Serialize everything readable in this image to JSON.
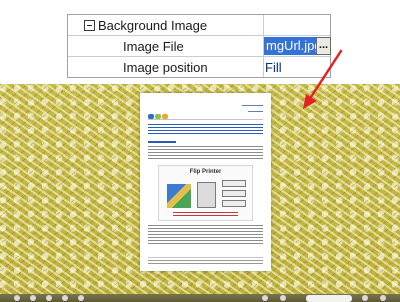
{
  "property_grid": {
    "category_label": "Background Image",
    "rows": [
      {
        "name": "Image File",
        "value": "mgUrl.jpg"
      },
      {
        "name": "Image position",
        "value": "Fill"
      }
    ],
    "browse_label": "..."
  },
  "preview": {
    "figure_title": "Flip Printer",
    "background_color": "#c8bd4a",
    "arrow_color": "#e02424"
  }
}
